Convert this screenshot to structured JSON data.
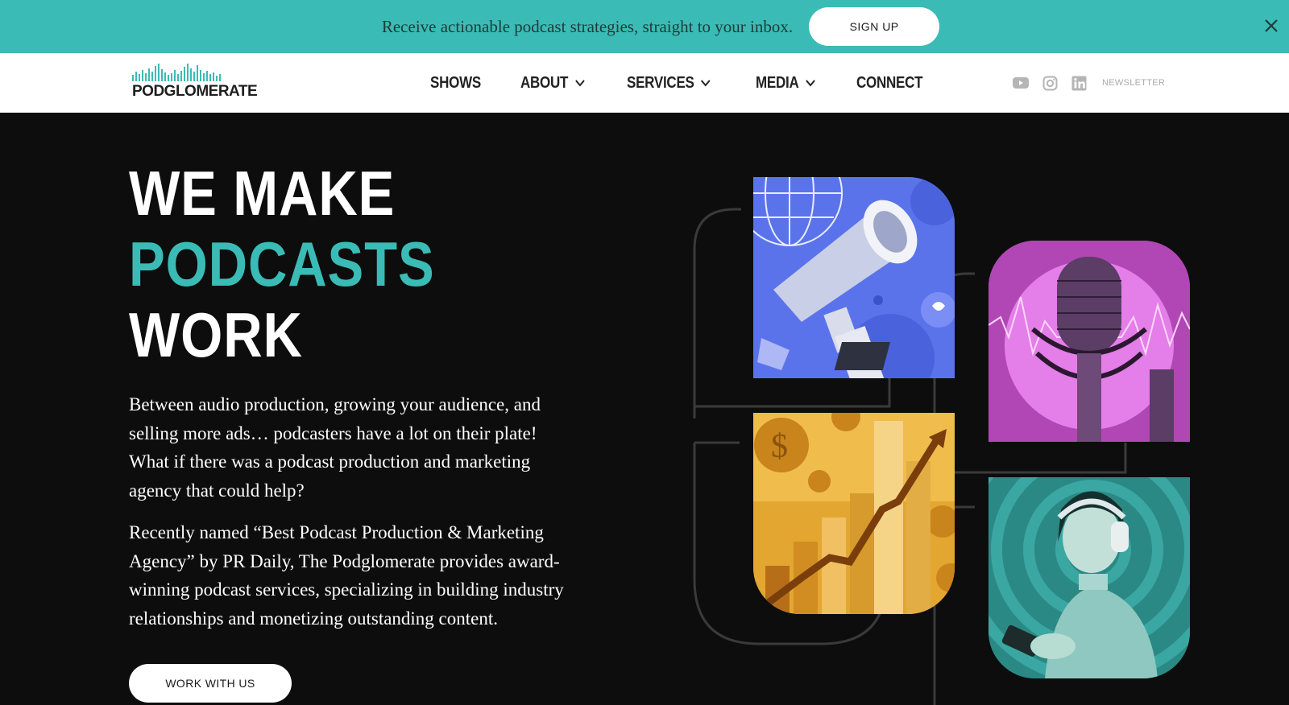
{
  "banner": {
    "text": "Receive actionable podcast strategies, straight to your inbox.",
    "button_label": "SIGN UP",
    "close_icon": "close-icon"
  },
  "header": {
    "logo_text": "PODGLOMERATE",
    "nav": [
      {
        "label": "SHOWS",
        "dropdown": false
      },
      {
        "label": "ABOUT",
        "dropdown": true
      },
      {
        "label": "SERVICES",
        "dropdown": true
      },
      {
        "label": "MEDIA",
        "dropdown": true
      },
      {
        "label": "CONNECT",
        "dropdown": false
      }
    ],
    "social": [
      "youtube-icon",
      "instagram-icon",
      "linkedin-icon"
    ],
    "newsletter_label": "NEWSLETTER"
  },
  "hero": {
    "title_line1": "WE MAKE",
    "title_line2": "PODCASTS",
    "title_line3": "WORK",
    "paragraph1": "Between audio production, growing your audience, and selling more ads… podcasters have a lot on their plate! What if there was a podcast production and marketing agency that could help?",
    "paragraph2": "Recently named “Best Podcast Production & Marketing Agency” by PR Daily, The Podglomerate provides award-winning podcast services, specializing in building industry relationships and monetizing outstanding content.",
    "cta_label": "WORK WITH US"
  },
  "colors": {
    "accent": "#3bbbb5",
    "background": "#0d0d0d",
    "header_bg": "#ffffff"
  }
}
